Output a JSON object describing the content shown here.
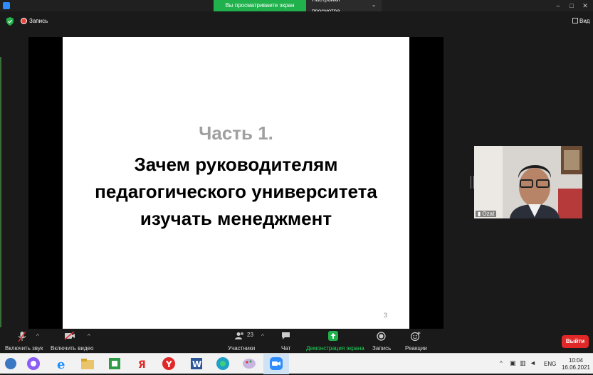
{
  "topbar": {
    "share_status": "Вы просматриваете экран Ozat",
    "view_options": "Настройки просмотра"
  },
  "toolbar": {
    "recording_label": "Запись",
    "view_label": "Вид"
  },
  "slide": {
    "part": "Часть 1.",
    "title_lines": [
      "Зачем руководителям",
      "педагогического университета",
      "изучать менеджмент"
    ],
    "page_number": "3"
  },
  "video": {
    "participant_name": "Ozat"
  },
  "controls": {
    "audio": "Включить звук",
    "video": "Включить видео",
    "participants": "Участники",
    "participants_count": "23",
    "chat": "Чат",
    "share": "Демонстрация экрана",
    "record": "Запись",
    "reactions": "Реакции",
    "leave": "Выйти"
  },
  "taskbar": {
    "lang": "ENG",
    "time": "10:04",
    "date": "16.06.2021"
  },
  "colors": {
    "share_green": "#20b14c",
    "leave_red": "#e02828",
    "record_red": "#e8453c"
  }
}
